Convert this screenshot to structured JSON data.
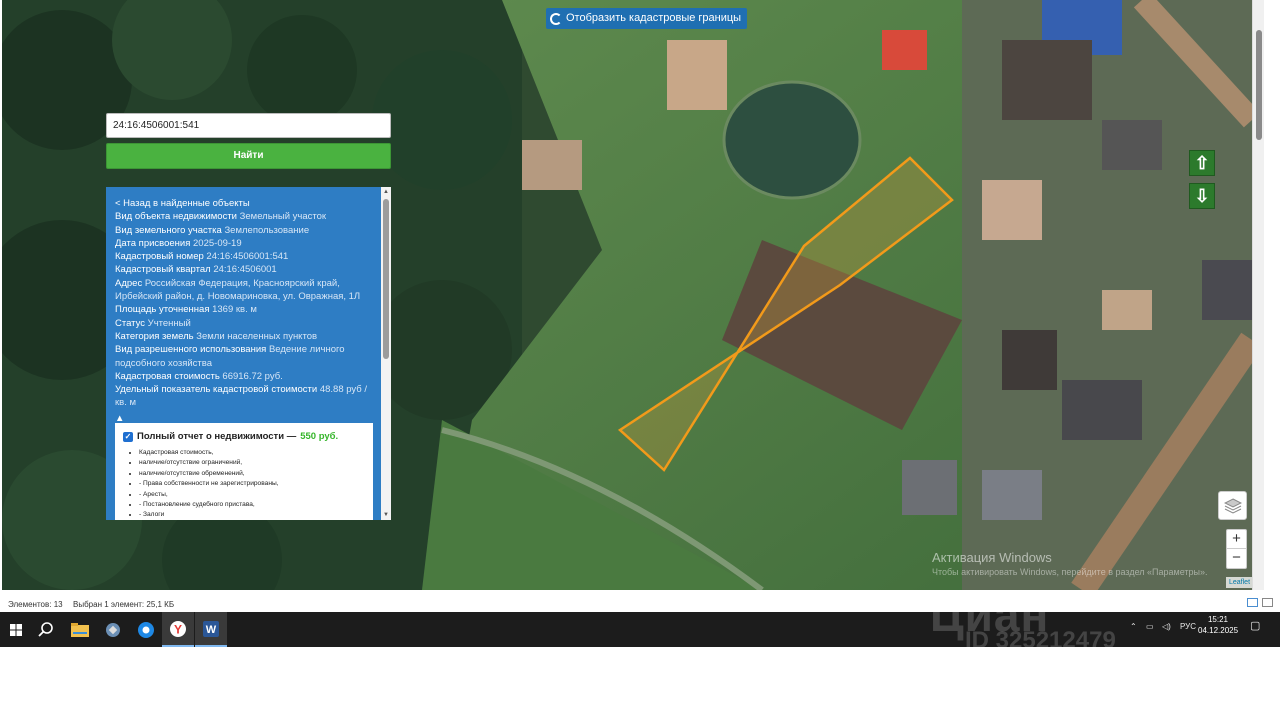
{
  "map": {
    "cadastral_toggle_label": "Отобразить кадастровые границы",
    "leaflet_attribution": "Leaflet",
    "windows_activation_title": "Активация Windows",
    "windows_activation_hint": "Чтобы активировать Windows, перейдите в раздел «Параметры»."
  },
  "search": {
    "query": "24:16:4506001:541",
    "button_label": "Найти"
  },
  "info": {
    "back_link": "< Назад в найденные объекты",
    "rows": [
      {
        "label": "Вид объекта недвижимости",
        "value": "Земельный участок"
      },
      {
        "label": "Вид земельного участка",
        "value": "Землепользование"
      },
      {
        "label": "Дата присвоения",
        "value": "2025-09-19"
      },
      {
        "label": "Кадастровый номер",
        "value": "24:16:4506001:541"
      },
      {
        "label": "Кадастровый квартал",
        "value": "24:16:4506001"
      },
      {
        "label": "Адрес",
        "value": "Российская Федерация, Красноярский край, Ирбейский район, д. Новомариновка, ул. Овражная, 1Л"
      },
      {
        "label": "Площадь уточненная",
        "value": "1369 кв. м"
      },
      {
        "label": "Статус",
        "value": "Учтенный"
      },
      {
        "label": "Категория земель",
        "value": "Земли населенных пунктов"
      },
      {
        "label": "Вид разрешенного использования",
        "value": "Ведение личного подсобного хозяйства"
      },
      {
        "label": "Кадастровая стоимость",
        "value": "66916.72 руб."
      },
      {
        "label": "Удельный показатель кадастровой стоимости",
        "value": "48.88 руб / кв. м"
      }
    ],
    "collapse_arrow": "▲",
    "report": {
      "checked": true,
      "title": "Полный отчет о недвижимости —",
      "price": "550 руб.",
      "items": [
        "Кадастровая стоимость,",
        "наличие/отсутствие ограничений,",
        "наличие/отсутствие обременений,",
        "- Права собственности не зарегистрированы,",
        "- Аресты,",
        "- Постановление судебного пристава,",
        "- Залоги"
      ]
    }
  },
  "explorer_status": {
    "items_count": "Элементов: 13",
    "selected": "Выбран 1 элемент: 25,1 КБ"
  },
  "taskbar": {
    "lang": "РУС",
    "time": "15:21",
    "date": "04.12.2025"
  },
  "watermark": {
    "brand": "Циан",
    "id": "ID 325212479"
  },
  "colors": {
    "panel_blue": "#2e7dc4",
    "button_green": "#4ab240",
    "parcel_outline": "#f29a1a",
    "price_green": "#35b52a"
  }
}
